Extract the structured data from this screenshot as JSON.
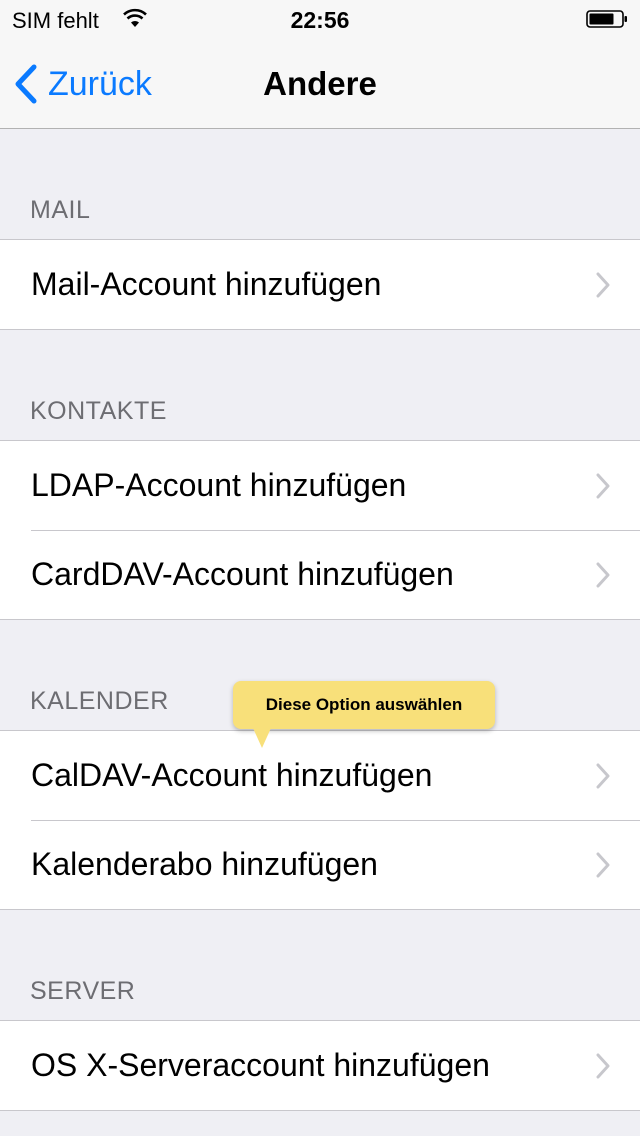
{
  "status_bar": {
    "carrier": "SIM fehlt",
    "time": "22:56",
    "wifi_icon": "wifi-icon",
    "battery_icon": "battery-icon"
  },
  "nav": {
    "back_label": "Zurück",
    "title": "Andere",
    "back_icon": "chevron-left-icon"
  },
  "sections": [
    {
      "header": "MAIL",
      "items": [
        "Mail-Account hinzufügen"
      ]
    },
    {
      "header": "KONTAKTE",
      "items": [
        "LDAP-Account hinzufügen",
        "CardDAV-Account hinzufügen"
      ]
    },
    {
      "header": "KALENDER",
      "items": [
        "CalDAV-Account hinzufügen",
        "Kalenderabo hinzufügen"
      ]
    },
    {
      "header": "SERVER",
      "items": [
        "OS X-Serveraccount hinzufügen"
      ]
    }
  ],
  "tooltip": {
    "text": "Diese Option auswählen"
  },
  "colors": {
    "accent": "#0a7aff",
    "background": "#efeff4",
    "tooltip": "#f8e07a"
  }
}
